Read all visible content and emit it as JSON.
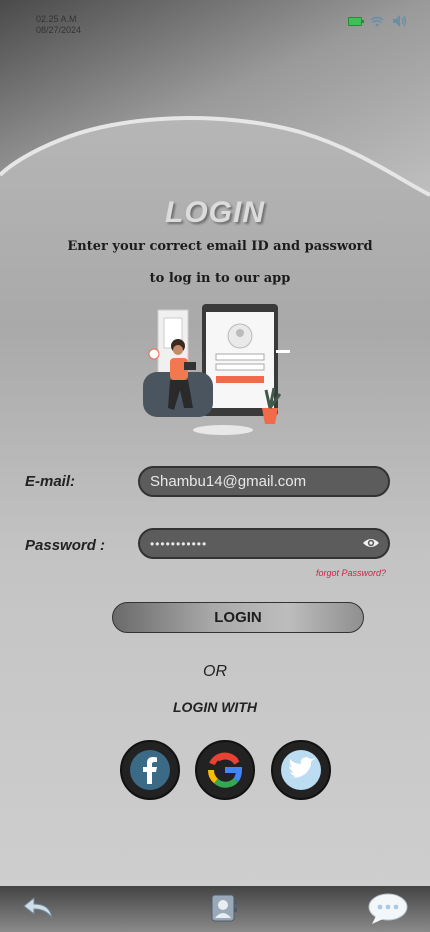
{
  "status": {
    "time": "02.25 A.M",
    "date": "08/27/2024"
  },
  "title": "LOGIN",
  "subtitle": {
    "line1": "Enter your correct email ID and password",
    "line2": "to log in to our app"
  },
  "form": {
    "email_label": "E-mail:",
    "email_value": "Shambu14@gmail.com",
    "password_label": "Password :",
    "password_value": "•••••••••••",
    "forgot": "forgot Password?",
    "login_button": "LOGIN"
  },
  "or_text": "OR",
  "login_with": "LOGIN WITH",
  "social": [
    "facebook",
    "google",
    "twitter"
  ],
  "colors": {
    "accent_red": "#d4224a",
    "field_bg": "#5c5c5c",
    "facebook": "#3b6a86"
  }
}
